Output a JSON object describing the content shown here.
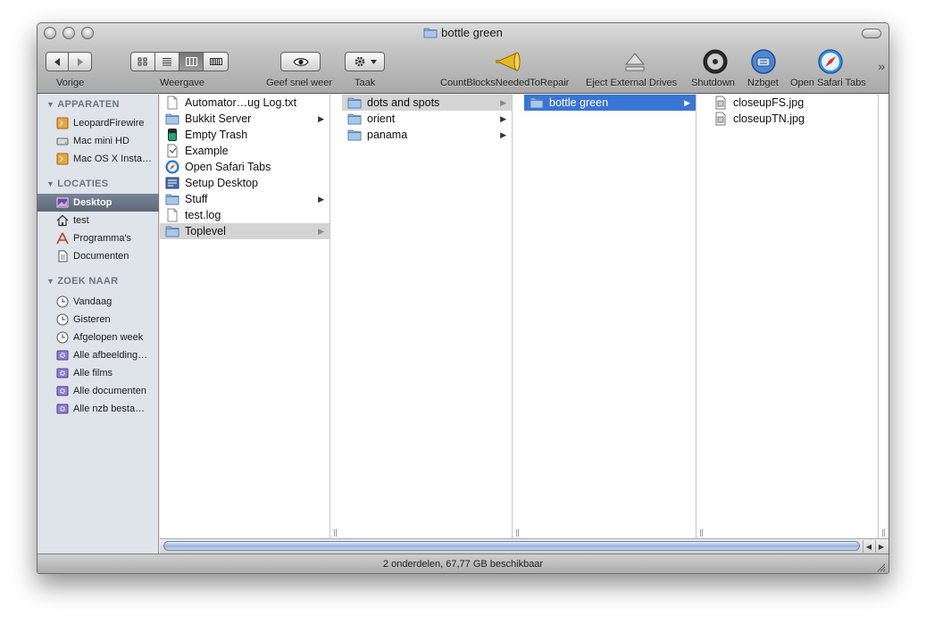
{
  "window": {
    "title": "bottle green"
  },
  "toolbar": {
    "back_label": "Vorige",
    "view_label": "Weergave",
    "quicklook_label": "Geef snel weer",
    "action_label": "Taak",
    "items": [
      {
        "label": "CountBlocksNeededToRepair",
        "icon": "megaphone-icon"
      },
      {
        "label": "Eject External Drives",
        "icon": "eject-icon"
      },
      {
        "label": "Shutdown",
        "icon": "disc-icon"
      },
      {
        "label": "Nzbget",
        "icon": "nzbget-icon"
      },
      {
        "label": "Open Safari Tabs",
        "icon": "safari-compass-icon"
      }
    ]
  },
  "sidebar": {
    "sections": [
      {
        "title": "APPARATEN",
        "items": [
          "LeopardFirewire",
          "Mac mini HD",
          "Mac OS X Insta…"
        ]
      },
      {
        "title": "LOCATIES",
        "items": [
          "Desktop",
          "test",
          "Programma's",
          "Documenten"
        ]
      },
      {
        "title": "ZOEK NAAR",
        "items": [
          "Vandaag",
          "Gisteren",
          "Afgelopen week",
          "Alle afbeelding…",
          "Alle films",
          "Alle documenten",
          "Alle nzb besta…"
        ]
      }
    ],
    "selected": "Desktop"
  },
  "columns": [
    {
      "items": [
        {
          "name": "Automator…ug Log.txt",
          "icon": "text-file-icon",
          "folder": false
        },
        {
          "name": "Bukkit Server",
          "icon": "folder-icon",
          "folder": true
        },
        {
          "name": "Empty Trash",
          "icon": "app-icon",
          "folder": false
        },
        {
          "name": "Example",
          "icon": "document-icon",
          "folder": false
        },
        {
          "name": "Open Safari Tabs",
          "icon": "safari-compass-icon",
          "folder": false
        },
        {
          "name": "Setup Desktop",
          "icon": "workflow-icon",
          "folder": false
        },
        {
          "name": "Stuff",
          "icon": "folder-icon",
          "folder": true
        },
        {
          "name": "test.log",
          "icon": "text-file-icon",
          "folder": false
        },
        {
          "name": "Toplevel",
          "icon": "folder-icon",
          "folder": true
        }
      ]
    },
    {
      "items": [
        {
          "name": "dots and spots",
          "icon": "folder-icon",
          "folder": true
        },
        {
          "name": "orient",
          "icon": "folder-icon",
          "folder": true
        },
        {
          "name": "panama",
          "icon": "folder-icon",
          "folder": true
        }
      ]
    },
    {
      "items": [
        {
          "name": "bottle green",
          "icon": "folder-icon",
          "folder": true
        }
      ]
    },
    {
      "items": [
        {
          "name": "closeupFS.jpg",
          "icon": "image-file-icon",
          "folder": false
        },
        {
          "name": "closeupTN.jpg",
          "icon": "image-file-icon",
          "folder": false
        }
      ]
    }
  ],
  "status": {
    "text": "2 onderdelen, 67,77 GB beschikbaar"
  }
}
